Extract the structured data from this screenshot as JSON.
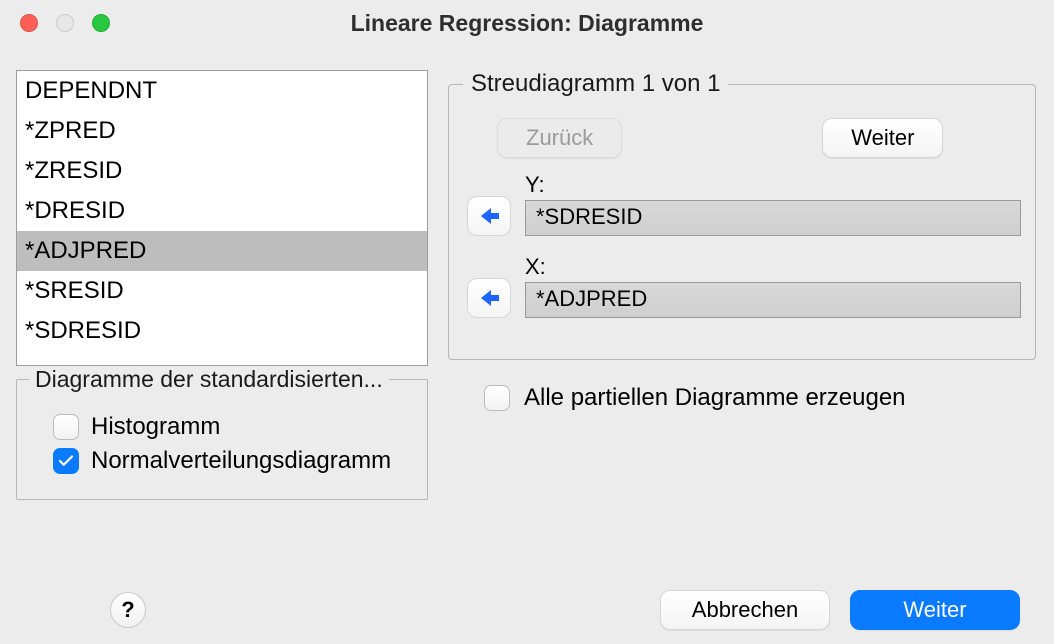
{
  "window": {
    "title": "Lineare Regression: Diagramme"
  },
  "variables": [
    {
      "name": "DEPENDNT",
      "selected": false
    },
    {
      "name": "*ZPRED",
      "selected": false
    },
    {
      "name": "*ZRESID",
      "selected": false
    },
    {
      "name": "*DRESID",
      "selected": false
    },
    {
      "name": "*ADJPRED",
      "selected": true
    },
    {
      "name": "*SRESID",
      "selected": false
    },
    {
      "name": "*SDRESID",
      "selected": false
    }
  ],
  "std_residual_plots": {
    "title": "Diagramme der standardisierten...",
    "histogram": {
      "label": "Histogramm",
      "checked": false
    },
    "normal_prob": {
      "label": "Normalverteilungsdiagramm",
      "checked": true
    }
  },
  "scatter": {
    "legend": "Streudiagramm 1 von 1",
    "previous_label": "Zurück",
    "previous_enabled": false,
    "next_label": "Weiter",
    "y_label": "Y:",
    "y_value": "*SDRESID",
    "x_label": "X:",
    "x_value": "*ADJPRED"
  },
  "partial_plots": {
    "label": "Alle partiellen Diagramme erzeugen",
    "checked": false
  },
  "buttons": {
    "help": "?",
    "cancel": "Abbrechen",
    "continue": "Weiter"
  }
}
